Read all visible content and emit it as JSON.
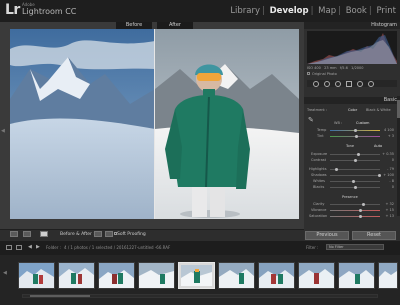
{
  "app": {
    "vendor": "Adobe",
    "logo": "Lr",
    "name": "Lightroom CC"
  },
  "modules": [
    "Library",
    "Develop",
    "Map",
    "Book",
    "Print"
  ],
  "active_module": "Develop",
  "view": {
    "before_label": "Before",
    "after_label": "After"
  },
  "toolbar": {
    "before_after_label": "Before & After :",
    "soft_proofing_label": "Soft Proofing"
  },
  "right_panel": {
    "histogram_title": "Histogram",
    "original_photo_label": "Original Photo",
    "basic_title": "Basic",
    "treatment_label": "Treatment :",
    "treatment_color": "Color",
    "treatment_bw": "Black & White",
    "wb_label": "WB :",
    "wb_value": "Custom",
    "temp_label": "Temp",
    "temp_value": "4 100",
    "tint_label": "Tint",
    "tint_value": "+ 3",
    "tone_label": "Tone",
    "auto_label": "Auto",
    "exposure_label": "Exposure",
    "exposure_value": "+ 0.35",
    "contrast_label": "Contrast",
    "contrast_value": "0",
    "highlights_label": "Highlights",
    "highlights_value": "- 79",
    "shadows_label": "Shadows",
    "shadows_value": "+ 100",
    "whites_label": "Whites",
    "whites_value": "- 8",
    "blacks_label": "Blacks",
    "blacks_value": "0",
    "presence_label": "Presence",
    "clarity_label": "Clarity",
    "clarity_value": "+ 32",
    "vibrance_label": "Vibrance",
    "vibrance_value": "+ 15",
    "saturation_label": "Saturation",
    "saturation_value": "+ 13",
    "previous_label": "Previous",
    "reset_label": "Reset"
  },
  "filmstrip": {
    "folder_label": "Folder :",
    "path_text": "4 / 1 photos / 1 selected / 20161227-untitled -66.RAF",
    "filter_label": "Filter :",
    "filter_value": "No Filter"
  },
  "colors": {
    "accent_active": "#eaeaea",
    "panel_bg": "#2f2f2f",
    "jacket": "#1f7a62",
    "helmet": "#3f95a0",
    "goggles": "#f0a53a"
  }
}
